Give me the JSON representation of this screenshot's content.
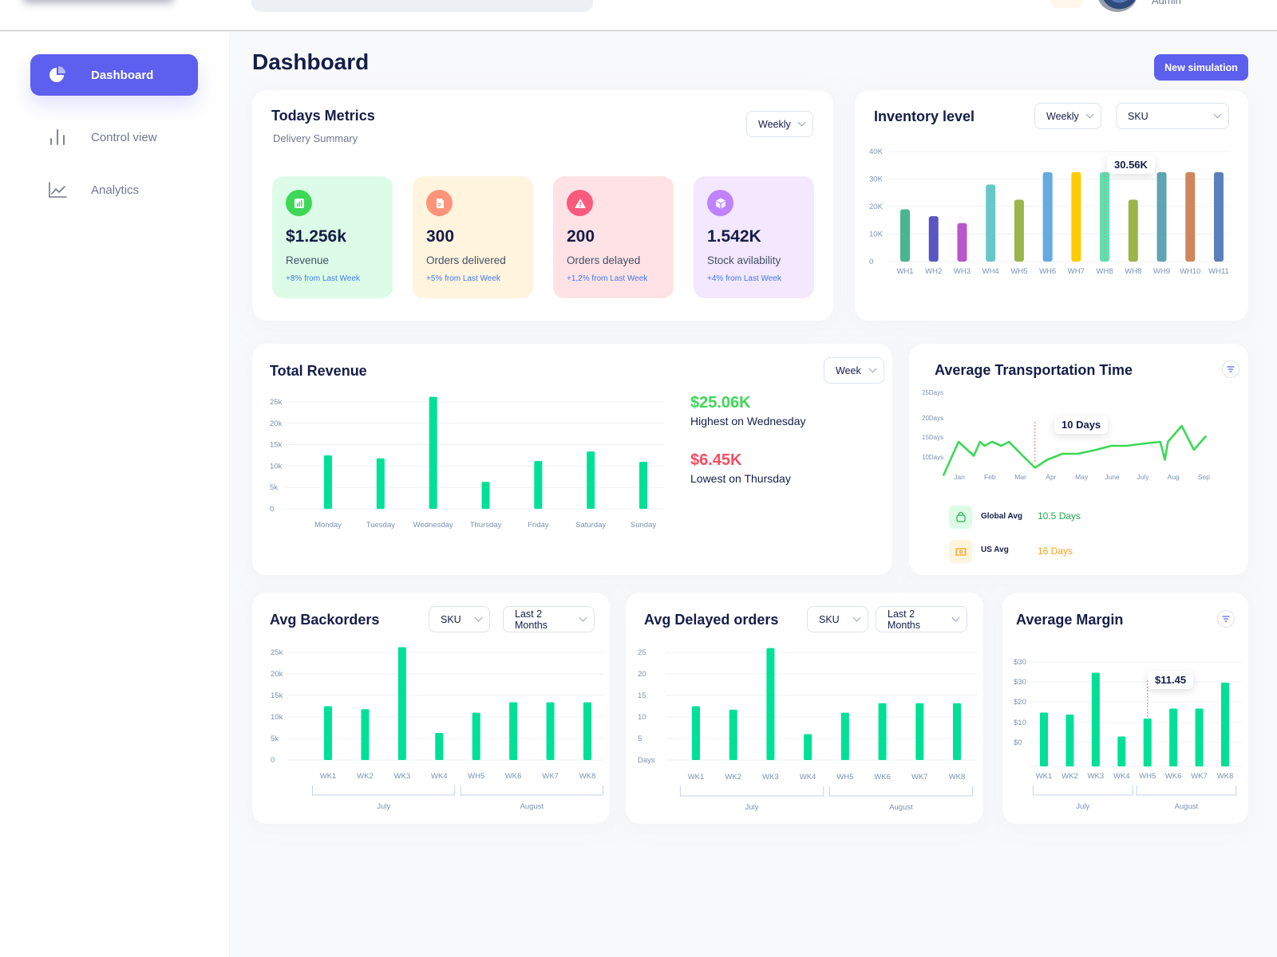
{
  "header": {
    "user_role": "Admin"
  },
  "sidebar": {
    "items": [
      {
        "label": "Dashboard",
        "icon": "pie-chart-icon",
        "active": true
      },
      {
        "label": "Control view",
        "icon": "bar-chart-icon",
        "active": false
      },
      {
        "label": "Analytics",
        "icon": "line-chart-icon",
        "active": false
      }
    ]
  },
  "page": {
    "title": "Dashboard",
    "new_simulation_label": "New simulation"
  },
  "todays_metrics": {
    "title": "Todays Metrics",
    "subtitle": "Delivery Summary",
    "period": "Weekly",
    "cards": [
      {
        "value": "$1.256k",
        "label": "Revenue",
        "change": "+8% from Last Week",
        "icon": "bar-chart-icon",
        "bg": "#dcfce7",
        "icon_bg": "#3cd856"
      },
      {
        "value": "300",
        "label": "Orders delivered",
        "change": "+5% from Last Week",
        "icon": "document-icon",
        "bg": "#fff4de",
        "icon_bg": "#fa5a7d"
      },
      {
        "value": "200",
        "label": "Orders delayed",
        "change": "+1,2% from Last Week",
        "icon": "warning-icon",
        "bg": "#ffe2e5",
        "icon_bg": "#fa5a7d"
      },
      {
        "value": "1.542K",
        "label": "Stock avilability",
        "change": "+4% from Last Week",
        "icon": "cube-icon",
        "bg": "#f3e8ff",
        "icon_bg": "#bf83ff"
      }
    ]
  },
  "inventory": {
    "title": "Inventory level",
    "period": "Weekly",
    "filter": "SKU",
    "tooltip": "30.56K"
  },
  "total_revenue": {
    "title": "Total Revenue",
    "period": "Week",
    "highest_value": "$25.06K",
    "highest_label": "Highest on Wednesday",
    "lowest_value": "$6.45K",
    "lowest_label": "Lowest on Thursday"
  },
  "transport": {
    "title": "Average Transportation Time",
    "tooltip": "10 Days",
    "legend": [
      {
        "label": "Global Avg",
        "value": "10.5 Days",
        "color": "#22b14c",
        "icon": "shopping-bag-icon"
      },
      {
        "label": "US Avg",
        "value": "16 Days",
        "color": "#ff9f1a",
        "icon": "ticket-icon"
      }
    ]
  },
  "backorders": {
    "title": "Avg Backorders",
    "filter": "SKU",
    "period": "Last 2 Months"
  },
  "delayed": {
    "title": "Avg Delayed orders",
    "filter": "SKU",
    "period": "Last 2 Months"
  },
  "margin": {
    "title": "Average Margin",
    "tooltip": "$11.45"
  },
  "chart_data": [
    {
      "id": "inventory",
      "type": "bar",
      "title": "Inventory level",
      "categories": [
        "WH1",
        "WH2",
        "WH3",
        "WH4",
        "WH5",
        "WH6",
        "WH7",
        "WH8",
        "WH8",
        "WH9",
        "WH10",
        "WH11"
      ],
      "values": [
        19000,
        16500,
        14000,
        28000,
        22500,
        32500,
        32500,
        32500,
        22500,
        32500,
        32500,
        32500
      ],
      "colors": [
        "#4ab58e",
        "#5955c2",
        "#b956cc",
        "#68c8c8",
        "#9cb54a",
        "#65aae1",
        "#ffcc00",
        "#5ee0b0",
        "#9cb54a",
        "#5fa4b2",
        "#cf865a",
        "#5a7fba"
      ],
      "yticks": [
        "0",
        "10K",
        "20K",
        "30K",
        "40K"
      ],
      "ylim": [
        0,
        40000
      ],
      "highlight_index": 7,
      "tooltip": "30.56K"
    },
    {
      "id": "total_revenue",
      "type": "bar",
      "title": "Total Revenue",
      "categories": [
        "Monday",
        "Tuesday",
        "Wednesday",
        "Thursday",
        "Friday",
        "Saturday",
        "Sunday"
      ],
      "values": [
        12500,
        11800,
        26200,
        6300,
        11200,
        13400,
        11000
      ],
      "yticks": [
        "0",
        "5k",
        "10k",
        "15k",
        "20k",
        "25k"
      ],
      "ylim": [
        0,
        25000
      ],
      "color": "#00e096"
    },
    {
      "id": "transport",
      "type": "line",
      "title": "Average Transportation Time",
      "xticks": [
        "Jan",
        "Feb",
        "Mar",
        "Apr",
        "May",
        "June",
        "July",
        "Aug",
        "Sep"
      ],
      "yticks": [
        "10Days",
        "15Days",
        "20Days",
        "25Days"
      ],
      "points_x": [
        0,
        0.5,
        1.0,
        1.2,
        1.35,
        1.6,
        1.9,
        2.15,
        2.6,
        3.0,
        3.4,
        3.9,
        4.4,
        5.0,
        5.5,
        6.0,
        6.5,
        7.1,
        7.25,
        7.35,
        7.8,
        8.2,
        8.6
      ],
      "points_y": [
        5.5,
        14,
        10.5,
        14,
        13,
        14,
        13,
        14,
        10.5,
        7.5,
        9.5,
        11,
        11,
        12,
        13,
        13,
        13.5,
        14,
        9.5,
        14,
        18,
        12,
        15.5
      ],
      "ylim": [
        5,
        25
      ],
      "color": "#3cd856",
      "tooltip": "10 Days",
      "tooltip_x": 3.0
    },
    {
      "id": "backorders",
      "type": "bar",
      "title": "Avg Backorders",
      "categories": [
        "WK1",
        "WK2",
        "WK3",
        "WK4",
        "WH5",
        "WK6",
        "WK7",
        "WK8"
      ],
      "groups": [
        {
          "label": "July",
          "from": 0,
          "to": 3
        },
        {
          "label": "August",
          "from": 4,
          "to": 7
        }
      ],
      "values": [
        12500,
        11800,
        26200,
        6300,
        11000,
        13400,
        13400,
        13400
      ],
      "yticks": [
        "0",
        "5k",
        "10k",
        "15k",
        "20k",
        "25k"
      ],
      "ylim": [
        0,
        25000
      ],
      "color": "#00e096"
    },
    {
      "id": "delayed",
      "type": "bar",
      "title": "Avg Delayed orders",
      "categories": [
        "WK1",
        "WK2",
        "WK3",
        "WK4",
        "WH5",
        "WK6",
        "WK7",
        "WK8"
      ],
      "groups": [
        {
          "label": "July",
          "from": 0,
          "to": 3
        },
        {
          "label": "August",
          "from": 4,
          "to": 7
        }
      ],
      "values": [
        12.5,
        11.7,
        26,
        6,
        11,
        13.2,
        13.2,
        13.2
      ],
      "yticks": [
        "Days",
        "5",
        "10",
        "15",
        "20",
        "25"
      ],
      "ylim": [
        0,
        25
      ],
      "color": "#00e096"
    },
    {
      "id": "margin",
      "type": "bar",
      "title": "Average Margin",
      "categories": [
        "WK1",
        "WK2",
        "WK3",
        "WK4",
        "WH5",
        "WK6",
        "WK7",
        "WK8"
      ],
      "groups": [
        {
          "label": "July",
          "from": 0,
          "to": 3
        },
        {
          "label": "August",
          "from": 4,
          "to": 7
        }
      ],
      "values": [
        15,
        14,
        35,
        3,
        12,
        17,
        17,
        30
      ],
      "yticks": [
        "$0",
        "$10",
        "$20",
        "$30",
        "$30"
      ],
      "ylim": [
        -10,
        40
      ],
      "color": "#00e096",
      "highlight_index": 4,
      "tooltip": "$11.45"
    }
  ]
}
